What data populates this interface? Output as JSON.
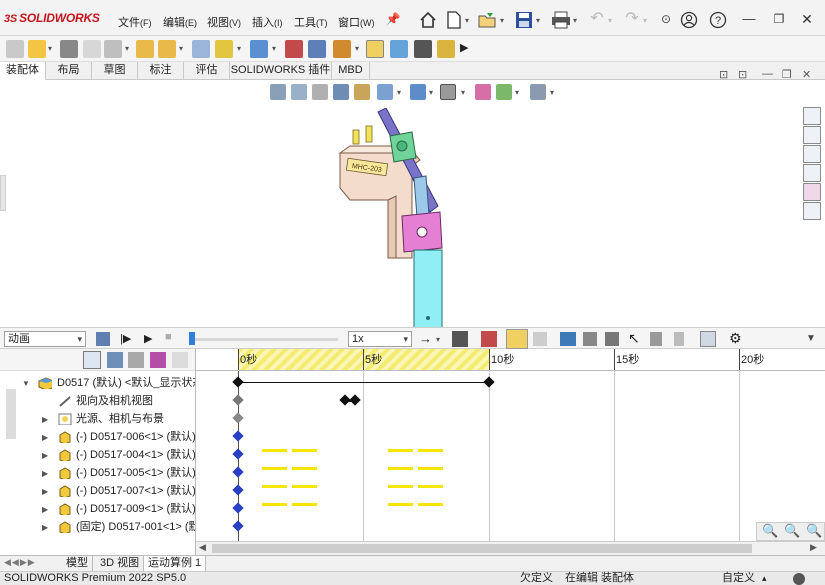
{
  "app": {
    "brand": "SOLIDWORKS",
    "menus": [
      {
        "label": "文件",
        "acc": "(F)"
      },
      {
        "label": "编辑",
        "acc": "(E)"
      },
      {
        "label": "视图",
        "acc": "(V)"
      },
      {
        "label": "插入",
        "acc": "(I)"
      },
      {
        "label": "工具",
        "acc": "(T)"
      },
      {
        "label": "窗口",
        "acc": "(W)"
      }
    ]
  },
  "command_tabs": [
    "装配体",
    "布局",
    "草图",
    "标注",
    "评估",
    "SOLIDWORKS 插件",
    "MBD"
  ],
  "part_label": "MHC-203",
  "animation": {
    "study_type": "动画",
    "playback_speed": "1x",
    "ruler_labels": [
      "0秒",
      "5秒",
      "10秒",
      "15秒",
      "20秒"
    ],
    "highlight_end_seconds": 10,
    "playhead_seconds": 0
  },
  "tree": {
    "root": "D0517 (默认) <默认_显示状态",
    "items": [
      {
        "label": "视向及相机视图",
        "icon": "camera-icon",
        "expandable": false
      },
      {
        "label": "光源、相机与布景",
        "icon": "lights-folder-icon",
        "expandable": true
      },
      {
        "label": "(-) D0517-006<1> (默认)",
        "icon": "part-icon",
        "expandable": true
      },
      {
        "label": "(-) D0517-004<1> (默认)",
        "icon": "part-icon",
        "expandable": true
      },
      {
        "label": "(-) D0517-005<1> (默认)",
        "icon": "part-icon",
        "expandable": true
      },
      {
        "label": "(-) D0517-007<1> (默认)",
        "icon": "part-icon",
        "expandable": true
      },
      {
        "label": "(-) D0517-009<1> (默认)",
        "icon": "part-icon",
        "expandable": true
      },
      {
        "label": "(固定) D0517-001<1> (默",
        "icon": "part-icon",
        "expandable": true
      }
    ]
  },
  "bottom_tabs": [
    "模型",
    "3D 视图",
    "运动算例 1"
  ],
  "status": {
    "product": "SOLIDWORKS Premium 2022 SP5.0",
    "underdefined": "欠定义",
    "editing": "在编辑 装配体",
    "custom": "自定义"
  },
  "colors": {
    "accent_red": "#c4161c",
    "timeline_highlight": "#f4ec6e",
    "key_blue": "#2b3fc5",
    "bar_yellow": "#f5e600"
  }
}
